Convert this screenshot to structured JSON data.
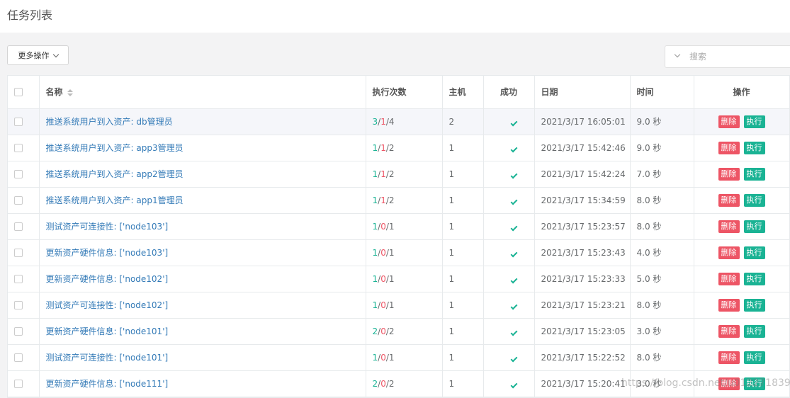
{
  "page": {
    "title": "任务列表"
  },
  "toolbar": {
    "more_actions_label": "更多操作"
  },
  "search": {
    "placeholder": "搜索"
  },
  "table": {
    "headers": {
      "name": "名称",
      "count": "执行次数",
      "host": "主机",
      "success": "成功",
      "date": "日期",
      "time": "时间",
      "actions": "操作"
    },
    "delete_label": "删除",
    "run_label": "执行",
    "rows": [
      {
        "name": "推送系统用户到入资产: db管理员",
        "ok": "3",
        "fail": "1",
        "total": "4",
        "host": "2",
        "date": "2021/3/17 16:05:01",
        "time": "9.0 秒"
      },
      {
        "name": "推送系统用户到入资产: app3管理员",
        "ok": "1",
        "fail": "1",
        "total": "2",
        "host": "1",
        "date": "2021/3/17 15:42:46",
        "time": "9.0 秒"
      },
      {
        "name": "推送系统用户到入资产: app2管理员",
        "ok": "1",
        "fail": "1",
        "total": "2",
        "host": "1",
        "date": "2021/3/17 15:42:24",
        "time": "7.0 秒"
      },
      {
        "name": "推送系统用户到入资产: app1管理员",
        "ok": "1",
        "fail": "1",
        "total": "2",
        "host": "1",
        "date": "2021/3/17 15:34:59",
        "time": "8.0 秒"
      },
      {
        "name": "测试资产可连接性: ['node103']",
        "ok": "1",
        "fail": "0",
        "total": "1",
        "host": "1",
        "date": "2021/3/17 15:23:57",
        "time": "8.0 秒"
      },
      {
        "name": "更新资产硬件信息: ['node103']",
        "ok": "1",
        "fail": "0",
        "total": "1",
        "host": "1",
        "date": "2021/3/17 15:23:43",
        "time": "4.0 秒"
      },
      {
        "name": "更新资产硬件信息: ['node102']",
        "ok": "1",
        "fail": "0",
        "total": "1",
        "host": "1",
        "date": "2021/3/17 15:23:33",
        "time": "5.0 秒"
      },
      {
        "name": "测试资产可连接性: ['node102']",
        "ok": "1",
        "fail": "0",
        "total": "1",
        "host": "1",
        "date": "2021/3/17 15:23:21",
        "time": "8.0 秒"
      },
      {
        "name": "更新资产硬件信息: ['node101']",
        "ok": "2",
        "fail": "0",
        "total": "2",
        "host": "1",
        "date": "2021/3/17 15:23:05",
        "time": "3.0 秒"
      },
      {
        "name": "测试资产可连接性: ['node101']",
        "ok": "1",
        "fail": "0",
        "total": "1",
        "host": "1",
        "date": "2021/3/17 15:22:52",
        "time": "8.0 秒"
      },
      {
        "name": "更新资产硬件信息: ['node111']",
        "ok": "2",
        "fail": "0",
        "total": "2",
        "host": "1",
        "date": "2021/3/17 15:20:41",
        "time": "3.0 秒"
      }
    ]
  },
  "watermark": "https://blog.csdn.net/u012271839",
  "colors": {
    "success": "#1ab394",
    "danger": "#ed5565",
    "link": "#337ab7"
  }
}
